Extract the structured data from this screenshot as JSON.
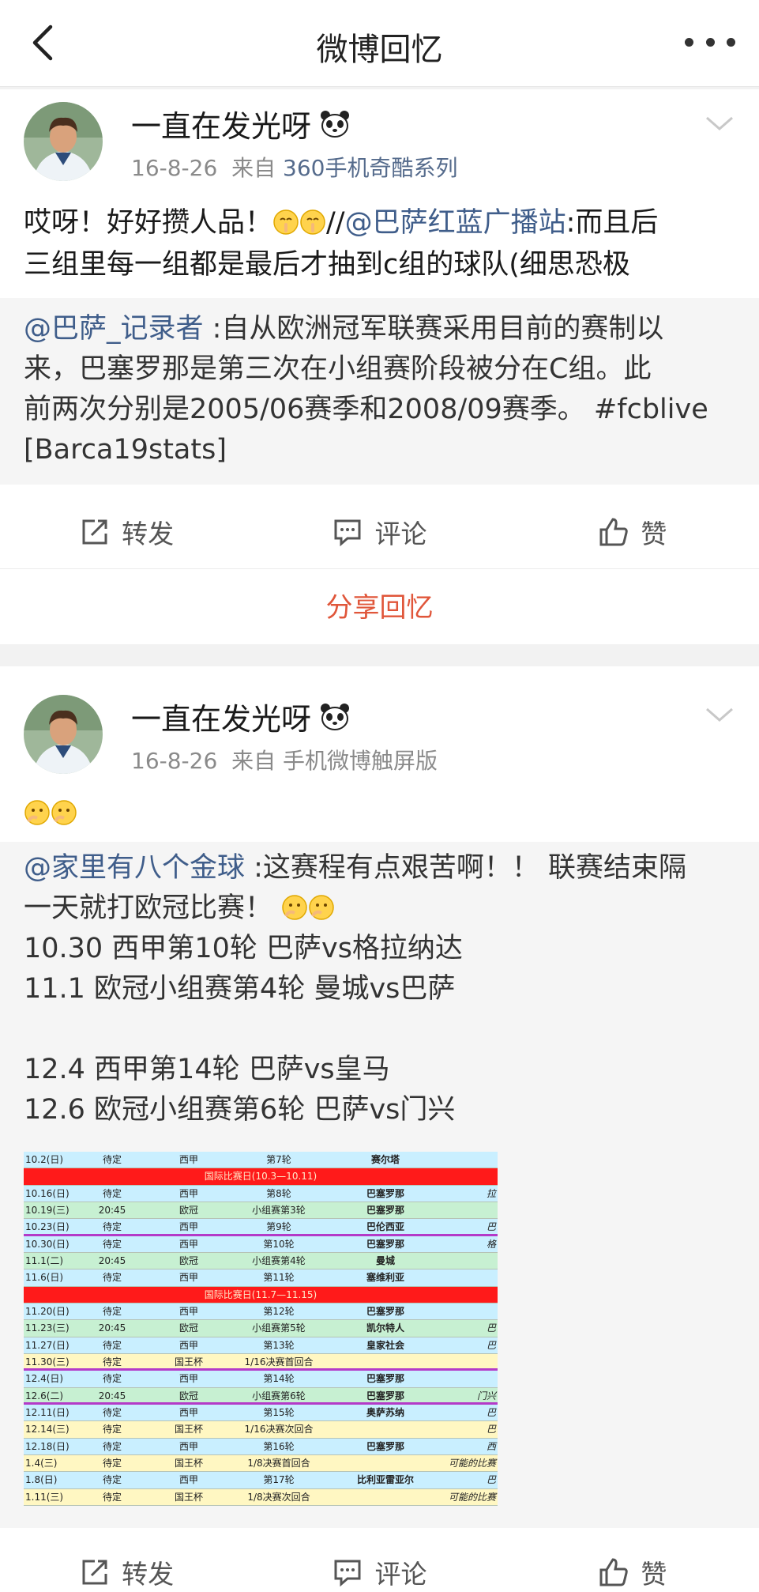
{
  "nav": {
    "title": "微博回忆"
  },
  "posts": [
    {
      "username": "一直在发光呀",
      "time": "16-8-26",
      "from_label": "来自",
      "source": "360手机奇酷系列",
      "text_1": "哎呀！好好攒人品！",
      "text_sep": "//",
      "text_mention": "@巴萨红蓝广播站",
      "text_2": ":而且后",
      "text_3": "三组里每一组都是最后才抽到c组的球队(细思恐极",
      "repost": {
        "mention": "@巴萨_记录者",
        "line1": " :自从欧洲冠军联赛采用目前的赛制以",
        "line2": "来，巴塞罗那是第三次在小组赛阶段被分在C组。此",
        "line3": "前两次分别是2005/06赛季和2008/09赛季。 #fcblive",
        "line4": "[Barca19stats]"
      },
      "actions": {
        "repost": "转发",
        "comment": "评论",
        "like": "赞"
      },
      "share_label": "分享回忆"
    },
    {
      "username": "一直在发光呀",
      "time": "16-8-26",
      "from_label": "来自",
      "source": "手机微博触屏版",
      "repost": {
        "mention": "@家里有八个金球",
        "line1": " :这赛程有点艰苦啊！！ 联赛结束隔",
        "line2": "一天就打欧冠比赛！",
        "line3": "10.30 西甲第10轮 巴萨vs格拉纳达",
        "line4": "11.1 欧冠小组赛第4轮 曼城vs巴萨",
        "line5": "12.4 西甲第14轮 巴萨vs皇马",
        "line6": "12.6 欧冠小组赛第6轮 巴萨vs门兴"
      },
      "actions": {
        "repost": "转发",
        "comment": "评论",
        "like": "赞"
      }
    }
  ],
  "schedule_rows": [
    {
      "kind": "row",
      "color": "#c9efff",
      "date": "10.2(日)",
      "time": "待定",
      "comp": "西甲",
      "round": "第7轮",
      "opp": "赛尔塔",
      "note": ""
    },
    {
      "kind": "red",
      "color": "#ff1a1a",
      "text": "国际比赛日(10.3—10.11)"
    },
    {
      "kind": "row",
      "color": "#c9efff",
      "date": "10.16(日)",
      "time": "待定",
      "comp": "西甲",
      "round": "第8轮",
      "opp": "巴塞罗那",
      "note": "拉"
    },
    {
      "kind": "row",
      "color": "#c7f0d2",
      "date": "10.19(三)",
      "time": "20:45",
      "comp": "欧冠",
      "round": "小组赛第3轮",
      "opp": "巴塞罗那",
      "note": ""
    },
    {
      "kind": "purple",
      "color": "#c9efff",
      "date": "10.23(日)",
      "time": "待定",
      "comp": "西甲",
      "round": "第9轮",
      "opp": "巴伦西亚",
      "note": "巴"
    },
    {
      "kind": "row",
      "color": "#c9efff",
      "date": "10.30(日)",
      "time": "待定",
      "comp": "西甲",
      "round": "第10轮",
      "opp": "巴塞罗那",
      "note": "格"
    },
    {
      "kind": "row",
      "color": "#c7f0d2",
      "date": "11.1(二)",
      "time": "20:45",
      "comp": "欧冠",
      "round": "小组赛第4轮",
      "opp": "曼城",
      "note": ""
    },
    {
      "kind": "row",
      "color": "#c9efff",
      "date": "11.6(日)",
      "time": "待定",
      "comp": "西甲",
      "round": "第11轮",
      "opp": "塞维利亚",
      "note": ""
    },
    {
      "kind": "red",
      "color": "#ff1a1a",
      "text": "国际比赛日(11.7—11.15)"
    },
    {
      "kind": "row",
      "color": "#c9efff",
      "date": "11.20(日)",
      "time": "待定",
      "comp": "西甲",
      "round": "第12轮",
      "opp": "巴塞罗那",
      "note": ""
    },
    {
      "kind": "row",
      "color": "#c7f0d2",
      "date": "11.23(三)",
      "time": "20:45",
      "comp": "欧冠",
      "round": "小组赛第5轮",
      "opp": "凯尔特人",
      "note": "巴"
    },
    {
      "kind": "row",
      "color": "#c9efff",
      "date": "11.27(日)",
      "time": "待定",
      "comp": "西甲",
      "round": "第13轮",
      "opp": "皇家社会",
      "note": "巴"
    },
    {
      "kind": "purple",
      "color": "#fff7c2",
      "date": "11.30(三)",
      "time": "待定",
      "comp": "国王杯",
      "round": "1/16决赛首回合",
      "opp": "",
      "note": ""
    },
    {
      "kind": "row",
      "color": "#c9efff",
      "date": "12.4(日)",
      "time": "待定",
      "comp": "西甲",
      "round": "第14轮",
      "opp": "巴塞罗那",
      "note": ""
    },
    {
      "kind": "purple",
      "color": "#c7f0d2",
      "date": "12.6(二)",
      "time": "20:45",
      "comp": "欧冠",
      "round": "小组赛第6轮",
      "opp": "巴塞罗那",
      "note": "门兴"
    },
    {
      "kind": "row",
      "color": "#c9efff",
      "date": "12.11(日)",
      "time": "待定",
      "comp": "西甲",
      "round": "第15轮",
      "opp": "奥萨苏纳",
      "note": "巴"
    },
    {
      "kind": "row",
      "color": "#fff7c2",
      "date": "12.14(三)",
      "time": "待定",
      "comp": "国王杯",
      "round": "1/16决赛次回合",
      "opp": "",
      "note": "巴"
    },
    {
      "kind": "row",
      "color": "#c9efff",
      "date": "12.18(日)",
      "time": "待定",
      "comp": "西甲",
      "round": "第16轮",
      "opp": "巴塞罗那",
      "note": "西"
    },
    {
      "kind": "row",
      "color": "#fff7c2",
      "date": "1.4(三)",
      "time": "待定",
      "comp": "国王杯",
      "round": "1/8决赛首回合",
      "opp": "",
      "note": "可能的比赛"
    },
    {
      "kind": "row",
      "color": "#c9efff",
      "date": "1.8(日)",
      "time": "待定",
      "comp": "西甲",
      "round": "第17轮",
      "opp": "比利亚雷亚尔",
      "note": "巴"
    },
    {
      "kind": "row",
      "color": "#fff7c2",
      "date": "1.11(三)",
      "time": "待定",
      "comp": "国王杯",
      "round": "1/8决赛次回合",
      "opp": "",
      "note": "可能的比赛"
    }
  ],
  "colors": {
    "link": "#3f5d8a",
    "share": "#e0563a"
  }
}
